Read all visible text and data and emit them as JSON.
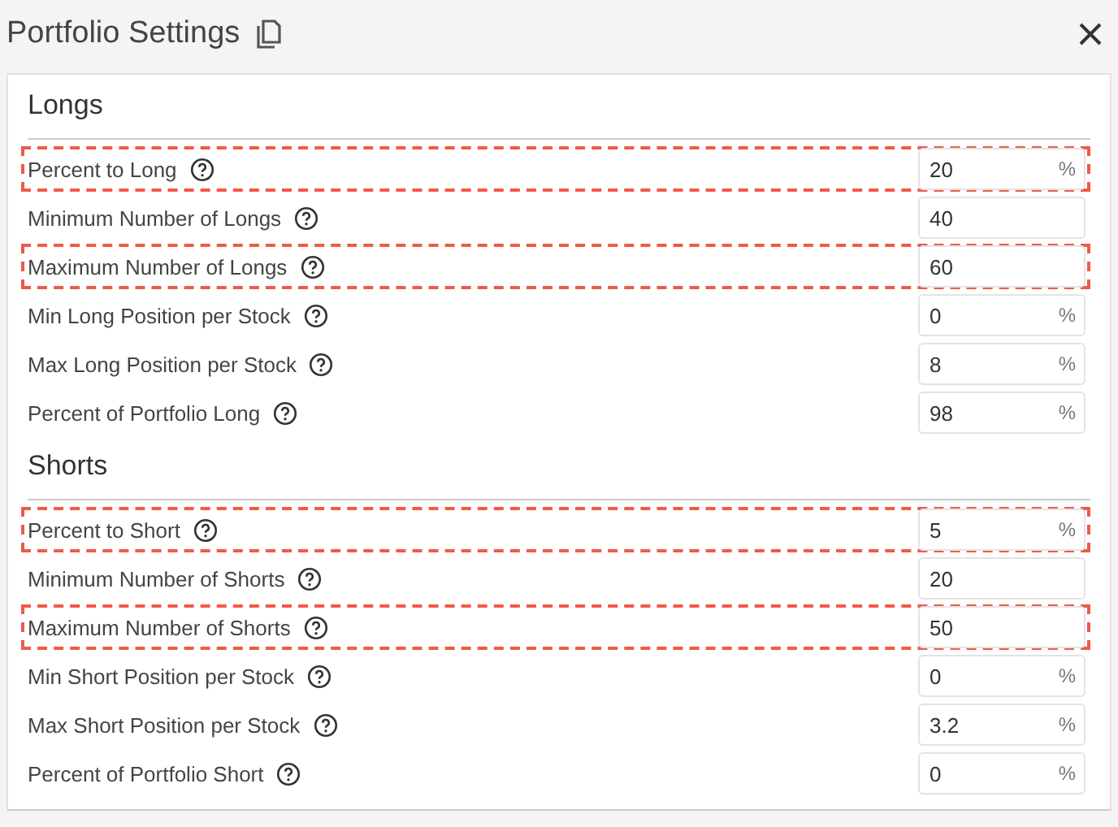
{
  "window": {
    "title": "Portfolio Settings"
  },
  "sections": [
    {
      "title": "Longs",
      "rows": [
        {
          "label": "Percent to Long",
          "value": "20",
          "unit": "%",
          "highlighted": true
        },
        {
          "label": "Minimum Number of Longs",
          "value": "40",
          "highlighted": false
        },
        {
          "label": "Maximum Number of Longs",
          "value": "60",
          "highlighted": true
        },
        {
          "label": "Min Long Position per Stock",
          "value": "0",
          "unit": "%",
          "highlighted": false
        },
        {
          "label": "Max Long Position per Stock",
          "value": "8",
          "unit": "%",
          "highlighted": false
        },
        {
          "label": "Percent of Portfolio Long",
          "value": "98",
          "unit": "%",
          "highlighted": false
        }
      ]
    },
    {
      "title": "Shorts",
      "rows": [
        {
          "label": "Percent to Short",
          "value": "5",
          "unit": "%",
          "highlighted": true
        },
        {
          "label": "Minimum Number of Shorts",
          "value": "20",
          "highlighted": false
        },
        {
          "label": "Maximum Number of Shorts",
          "value": "50",
          "highlighted": true
        },
        {
          "label": "Min Short Position per Stock",
          "value": "0",
          "unit": "%",
          "highlighted": false
        },
        {
          "label": "Max Short Position per Stock",
          "value": "3.2",
          "unit": "%",
          "highlighted": false
        },
        {
          "label": "Percent of Portfolio Short",
          "value": "0",
          "unit": "%",
          "highlighted": false
        }
      ]
    }
  ]
}
